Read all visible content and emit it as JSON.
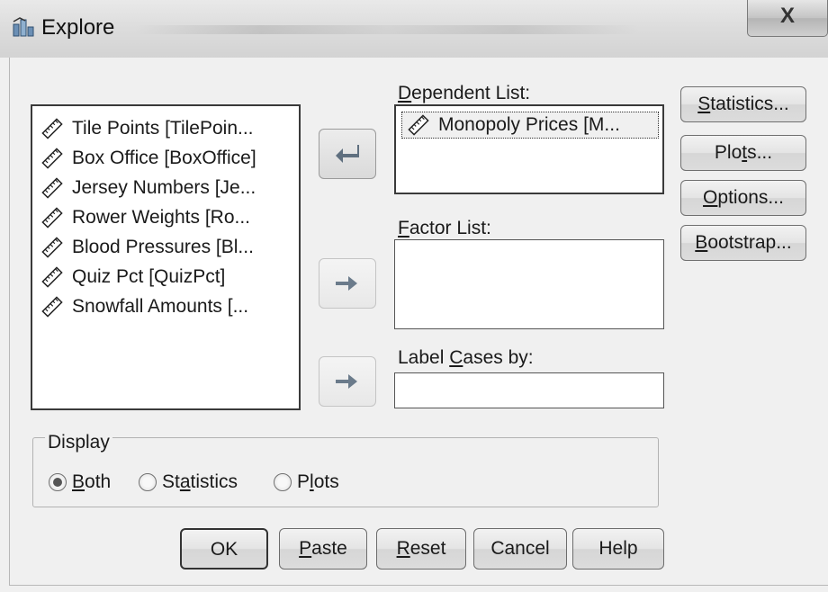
{
  "window": {
    "title": "Explore",
    "close_glyph": "X"
  },
  "variables": {
    "items": [
      {
        "label": "Tile Points [TilePoin...",
        "icon": "ruler-scale-icon"
      },
      {
        "label": "Box Office [BoxOffice]",
        "icon": "ruler-scale-icon"
      },
      {
        "label": "Jersey Numbers [Je...",
        "icon": "ruler-scale-icon"
      },
      {
        "label": "Rower Weights [Ro...",
        "icon": "ruler-scale-icon"
      },
      {
        "label": "Blood Pressures [Bl...",
        "icon": "ruler-scale-icon"
      },
      {
        "label": "Quiz Pct [QuizPct]",
        "icon": "ruler-scale-icon"
      },
      {
        "label": "Snowfall Amounts [...",
        "icon": "ruler-scale-icon"
      }
    ]
  },
  "dependent_list": {
    "label_u": "D",
    "label_rest": "ependent List:",
    "items": [
      {
        "label": "Monopoly Prices [M...",
        "icon": "ruler-scale-icon"
      }
    ]
  },
  "factor_list": {
    "label_u": "F",
    "label_rest": "actor List:"
  },
  "label_cases": {
    "label_pre": "Label ",
    "label_u": "C",
    "label_rest": "ases by:",
    "value": ""
  },
  "side_buttons": {
    "statistics": {
      "u": "S",
      "rest": "tatistics..."
    },
    "plots": {
      "pre": "Plo",
      "u": "t",
      "rest": "s..."
    },
    "options": {
      "u": "O",
      "rest": "ptions..."
    },
    "bootstrap": {
      "u": "B",
      "rest": "ootstrap..."
    }
  },
  "display": {
    "title": "Display",
    "selected": "Both",
    "options": {
      "both": {
        "pre": "",
        "u": "B",
        "rest": "oth"
      },
      "statistics": {
        "pre": "St",
        "u": "a",
        "rest": "tistics"
      },
      "plots": {
        "pre": "P",
        "u": "l",
        "rest": "ots"
      }
    }
  },
  "bottom_buttons": {
    "ok": {
      "label": "OK"
    },
    "paste": {
      "u": "P",
      "rest": "aste"
    },
    "reset": {
      "u": "R",
      "rest": "eset"
    },
    "cancel": {
      "label": "Cancel"
    },
    "help": {
      "label": "Help"
    }
  }
}
